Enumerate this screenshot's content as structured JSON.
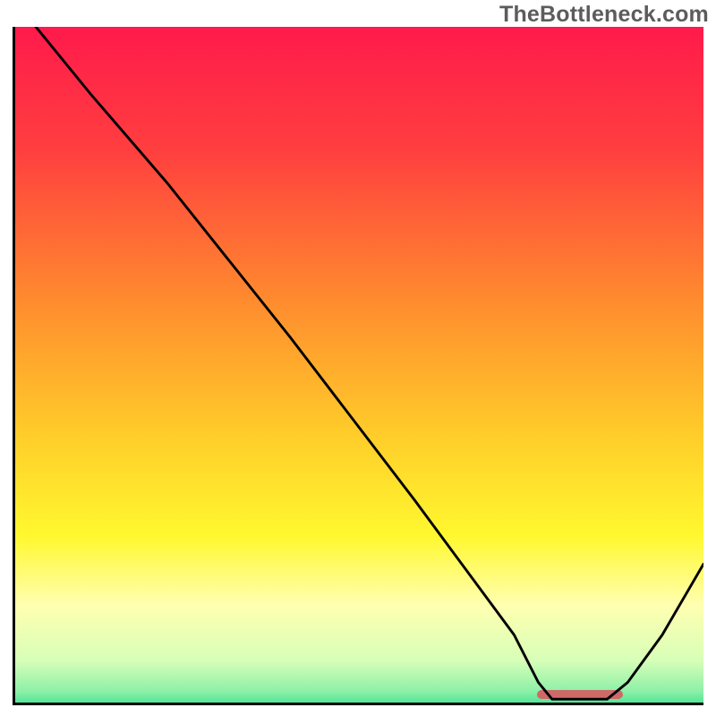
{
  "watermark": "TheBottleneck.com",
  "colors": {
    "axis": "#000000",
    "curve": "#000000",
    "bar": "#cd6a68",
    "gradient_stops": [
      {
        "offset": 0.0,
        "color": "#ff1a4b"
      },
      {
        "offset": 0.18,
        "color": "#ff3f3f"
      },
      {
        "offset": 0.4,
        "color": "#ff8c2e"
      },
      {
        "offset": 0.6,
        "color": "#ffcf2a"
      },
      {
        "offset": 0.74,
        "color": "#fff82f"
      },
      {
        "offset": 0.84,
        "color": "#ffffb0"
      },
      {
        "offset": 0.92,
        "color": "#d8ffb8"
      },
      {
        "offset": 0.965,
        "color": "#8ef0a8"
      },
      {
        "offset": 1.0,
        "color": "#17d987"
      }
    ]
  },
  "chart_data": {
    "type": "line",
    "title": "",
    "xlabel": "",
    "ylabel": "",
    "xlim": [
      0,
      100
    ],
    "ylim": [
      0,
      100
    ],
    "series": [
      {
        "name": "curve",
        "points": [
          {
            "x": 3.0,
            "y": 100.0
          },
          {
            "x": 11.0,
            "y": 90.0
          },
          {
            "x": 22.0,
            "y": 77.0
          },
          {
            "x": 40.0,
            "y": 54.0
          },
          {
            "x": 58.0,
            "y": 30.0
          },
          {
            "x": 72.5,
            "y": 10.0
          },
          {
            "x": 76.0,
            "y": 3.0
          },
          {
            "x": 78.0,
            "y": 0.5
          },
          {
            "x": 86.0,
            "y": 0.5
          },
          {
            "x": 89.0,
            "y": 3.0
          },
          {
            "x": 94.0,
            "y": 10.0
          },
          {
            "x": 100.0,
            "y": 20.5
          }
        ]
      }
    ],
    "highlight_bar": {
      "x_start": 75.5,
      "x_end": 88.0,
      "y": 0
    }
  }
}
